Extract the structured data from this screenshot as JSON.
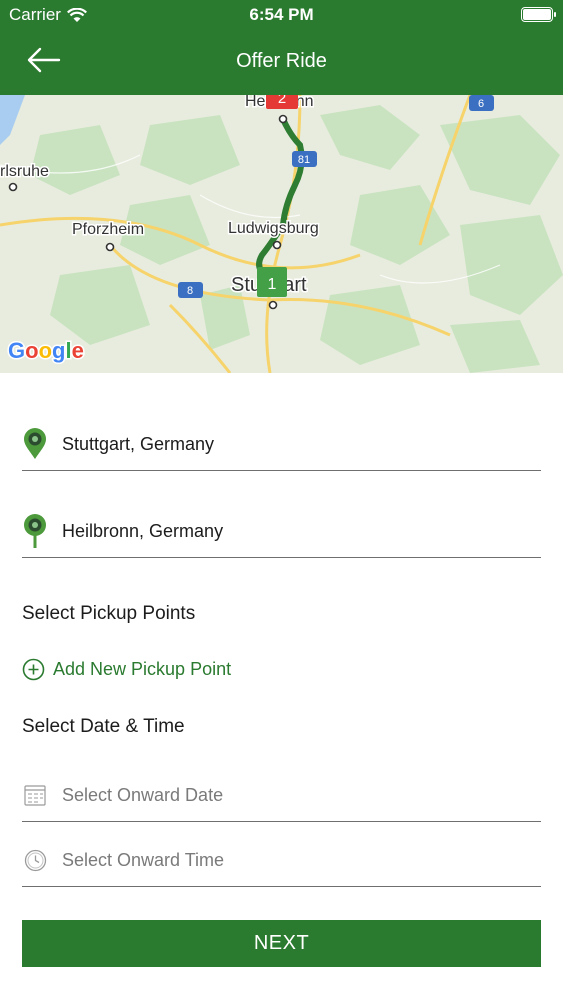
{
  "status_bar": {
    "carrier": "Carrier",
    "time": "6:54 PM"
  },
  "header": {
    "title": "Offer Ride",
    "accent_color": "#2a7a2f"
  },
  "map": {
    "places": [
      "Heilbronn",
      "rlsruhe",
      "Pforzheim",
      "Ludwigsburg",
      "Stuttgart"
    ],
    "road_badges": [
      "6",
      "81",
      "8"
    ],
    "markers": [
      "2",
      "1"
    ],
    "logo": "Google"
  },
  "route": {
    "from": "Stuttgart, Germany",
    "to": "Heilbronn, Germany"
  },
  "pickup": {
    "section_title": "Select Pickup Points",
    "add_label": "Add New Pickup Point"
  },
  "datetime": {
    "section_title": "Select Date & Time",
    "date_placeholder": "Select Onward Date",
    "time_placeholder": "Select Onward Time"
  },
  "next_label": "NEXT"
}
